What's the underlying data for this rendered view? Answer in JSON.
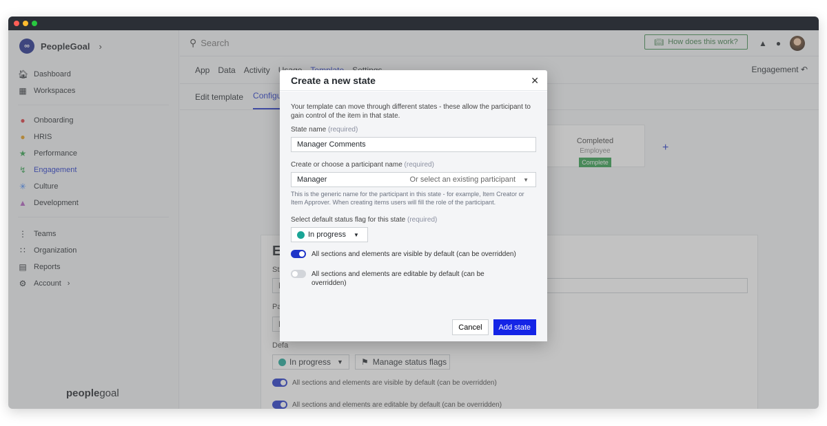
{
  "sidebar": {
    "brand": "PeopleGoal",
    "items_top": [
      {
        "label": "Dashboard",
        "icon": "home-icon"
      },
      {
        "label": "Workspaces",
        "icon": "grid-icon"
      }
    ],
    "items_modules": [
      {
        "label": "Onboarding",
        "icon": "onboarding-icon"
      },
      {
        "label": "HRIS",
        "icon": "hris-icon"
      },
      {
        "label": "Performance",
        "icon": "star-icon"
      },
      {
        "label": "Engagement",
        "icon": "bolt-icon"
      },
      {
        "label": "Culture",
        "icon": "asterisk-icon"
      },
      {
        "label": "Development",
        "icon": "graduation-cap-icon"
      }
    ],
    "items_bottom": [
      {
        "label": "Teams",
        "icon": "teams-icon"
      },
      {
        "label": "Organization",
        "icon": "organization-icon"
      },
      {
        "label": "Reports",
        "icon": "reports-icon"
      },
      {
        "label": "Account",
        "icon": "gear-icon"
      }
    ],
    "footer_bold": "people",
    "footer_regular": "goal",
    "active_color": "#1f35c8"
  },
  "topbar": {
    "search_placeholder": "Search",
    "help_label": "How does this work?"
  },
  "tabs": [
    "App",
    "Data",
    "Activity",
    "Usage",
    "Template",
    "Settings"
  ],
  "active_tab": "Template",
  "module_name": "Engagement",
  "subtabs": [
    "Edit template",
    "Configu"
  ],
  "state_card": {
    "title": "Completed",
    "role": "Employee",
    "badge": "Complete",
    "badge_color": "#2e9e4b"
  },
  "edit_panel": {
    "title": "Edi",
    "state_label": "State",
    "state_value": "Ne",
    "participant_label": "Parti",
    "participant_value": "Em",
    "default_label": "Defa",
    "status_value": "In progress",
    "manage_flags_label": "Manage status flags",
    "visible_toggle_label": "All sections and elements are visible by default (can be overridden)",
    "editable_toggle_label": "All sections and elements are editable by default (can be overridden)"
  },
  "modal": {
    "title": "Create a new state",
    "intro": "Your template can move through different states - these allow the participant to gain control of the item in that state.",
    "state_name_label": "State name",
    "required_text": "(required)",
    "state_name_value": "Manager Comments",
    "participant_label": "Create or choose a participant name",
    "participant_value": "Manager",
    "participant_select": "Or select an existing participant",
    "participant_hint": "This is the generic name for the participant in this state - for example, Item Creator or Item Approver. When creating items users will fill the role of the participant.",
    "status_label": "Select default status flag for this state",
    "status_value": "In progress",
    "status_color": "#1aa596",
    "visible_toggle_label": "All sections and elements are visible by default (can be overridden)",
    "visible_toggle_on": true,
    "editable_toggle_label": "All sections and elements are editable by default (can be overridden)",
    "editable_toggle_on": false,
    "cancel_label": "Cancel",
    "add_label": "Add state",
    "add_color": "#1424e6"
  }
}
